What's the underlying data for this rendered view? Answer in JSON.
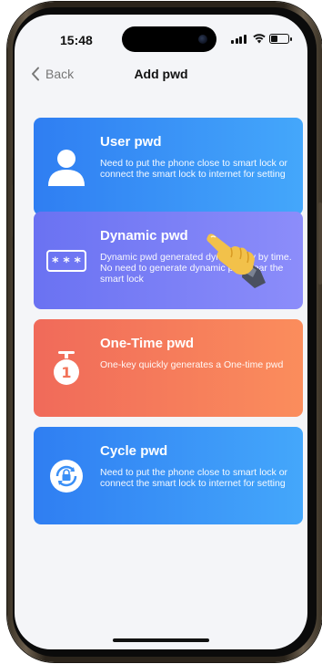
{
  "status_bar": {
    "time": "15:48"
  },
  "header": {
    "back_label": "Back",
    "title": "Add pwd"
  },
  "options": [
    {
      "title": "User pwd",
      "description": "Need to put the phone close to smart lock or connect the smart lock to internet for setting",
      "icon": "user-icon"
    },
    {
      "title": "Dynamic pwd",
      "description": "Dynamic pwd generated dynamically by time. No need to generate dynamic pwd near the smart lock",
      "icon": "keypad-icon"
    },
    {
      "title": "One-Time pwd",
      "description": "One-key quickly generates a One-time pwd",
      "icon": "timer-one-icon"
    },
    {
      "title": "Cycle pwd",
      "description": "Need to put the phone close to smart lock or connect the smart lock to internet for setting",
      "icon": "cycle-lock-icon"
    }
  ],
  "colors": {
    "user_card": "#3a8ff6",
    "dynamic_card": "#7a80f6",
    "one_time_card": "#f57a5b",
    "cycle_card": "#3a8ff6"
  }
}
